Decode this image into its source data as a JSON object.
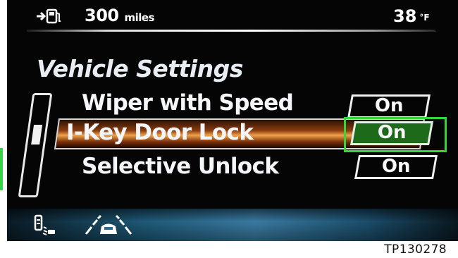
{
  "status": {
    "range_value": "300",
    "range_unit": "miles",
    "temperature_value": "38",
    "temperature_unit": "°F",
    "fuel_icon": "fuel-range-icon"
  },
  "menu": {
    "title": "Vehicle Settings",
    "items": [
      {
        "label": "Wiper with Speed",
        "value": "On",
        "selected": false
      },
      {
        "label": "I-Key Door Lock",
        "value": "On",
        "selected": true
      },
      {
        "label": "Selective Unlock",
        "value": "On",
        "selected": false
      }
    ],
    "scroll_position": 0.3
  },
  "bottom_icons": [
    "sonar-sensor-icon",
    "lane-departure-icon"
  ],
  "caption": "TP130278",
  "colors": {
    "background": "#050505",
    "highlight": "#c4671f",
    "focus": "#34d63a",
    "toggle_on": "#1d6a1b",
    "bottom_bar": "#2b6b90"
  }
}
